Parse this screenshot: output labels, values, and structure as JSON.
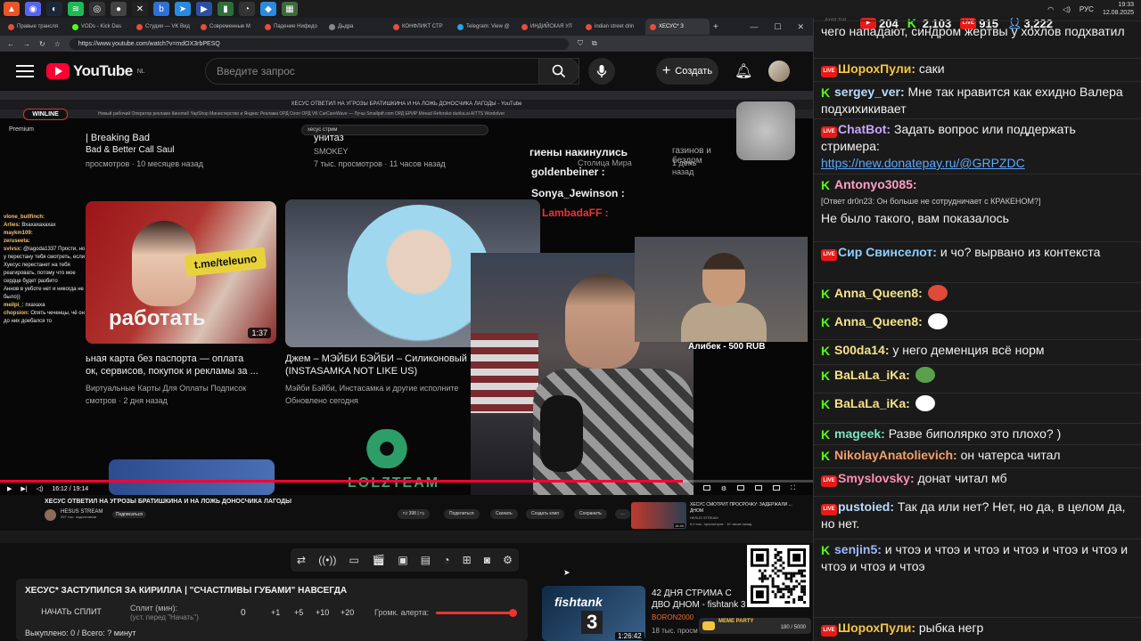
{
  "os": {
    "clock_time": "19:33",
    "clock_date": "12.08.2025",
    "lang": "РУС"
  },
  "browser": {
    "tabs": [
      {
        "label": "Правые трансля",
        "color": "#e74c3c"
      },
      {
        "label": "VODs - Kick Das",
        "color": "#53fc18"
      },
      {
        "label": "Студия — VK Вид",
        "color": "#e74c3c"
      },
      {
        "label": "Современные М",
        "color": "#e74c3c"
      },
      {
        "label": "Падение Нифедо",
        "color": "#e74c3c"
      },
      {
        "label": "Дьдра",
        "color": "#888888"
      },
      {
        "label": "КОНФЛИКТ СТР",
        "color": "#e74c3c"
      },
      {
        "label": "Telegram: View @",
        "color": "#2aa3e0"
      },
      {
        "label": "ИНДИЙСКАЯ УЛ",
        "color": "#e74c3c"
      },
      {
        "label": "indian street drin",
        "color": "#e74c3c"
      },
      {
        "label": "ХЕСУС* З",
        "color": "#e74c3c",
        "active": true
      }
    ],
    "url": "https://www.youtube.com/watch?v=mdOX3rbPESQ"
  },
  "youtube": {
    "logo_text": "YouTube",
    "region": "NL",
    "search_placeholder": "Введите запрос",
    "create_label": "Создать"
  },
  "player": {
    "winline": "WINLINE",
    "premium": "Premium",
    "inner_page_title": "ХЕСУС ОТВЕТИЛ НА УГРОЗЫ БРАТИШКИНА И НА ЛОЖЬ ДОНОСЧИКА ЛАГОДЫ - YouTube",
    "inner_bookmarks": "Новый рабочий   Оператор рекламн   Кинопаб   YapShop   Министерство и   Яндекс Реклама   ОРД Ozon   ОРД VK   CarCareWave — Лучш   Smallpdf.com   ОРД ЕРИР   Miread   Reforoko   durika.ai   AITTS   Wordolver",
    "inner_search": "хесус стрим",
    "videos": [
      {
        "title": "Bad & Better Call Saul",
        "meta": "просмотров · 10 месяцев назад",
        "title_pre": "| Breaking Bad"
      },
      {
        "title": "унитаз",
        "channel": "SMOKEY",
        "meta": "7 тыс. просмотров · 11 часов назад"
      },
      {
        "title": "ьная карта без паспорта — оплата",
        "title2": "ок, сервисов, покупок и рекламы за ...",
        "meta": "Виртуальные Карты Для Оплаты Подписок",
        "meta2": "смотров · 2 дня назад",
        "duration": "1:37",
        "thumb_tag": "t.me/teleuno",
        "thumb_caption": "работать"
      },
      {
        "title": "Джем – МЭЙБИ БЭЙБИ – Силиконовый",
        "title2": "(INSTASAMKA NOT LIKE US)",
        "meta": "Мэйби Бэйби, Инстасамка и другие исполните",
        "meta2": "Обновлено сегодня"
      }
    ],
    "overlay_right": {
      "line1": "гиены накинулись",
      "line1_sub": "Столица Мира",
      "line2": "goldenbeiner :",
      "line3": "Sonya_Jewinson :",
      "line4": "LambadaFF :",
      "top_text": "газинов и бездом",
      "top_meta": "1 день назад"
    },
    "chat_overlay": [
      {
        "user": "vlone_bullfinch:",
        "text": ""
      },
      {
        "user": "Arlies:",
        "text": "Вхахахахахах"
      },
      {
        "user": "maykm109:",
        "text": ""
      },
      {
        "user": "zeruseeta:",
        "text": ""
      },
      {
        "user": "svivsx:",
        "text": "@lagoda1337 Прости, но у перестану тебя смотреть, если Хуесус перестанет на тебя реагировать, потому что мое сердце будет разбито"
      },
      {
        "user": "",
        "text": "Аннов в уеботе нет и никогда не было))"
      },
      {
        "user": "meilpi_:",
        "text": "пхахаха"
      },
      {
        "user": "chopsion:",
        "text": "Опять чеченцы, чё он до них доебался то"
      }
    ],
    "donation": "Алибек - 500 RUB",
    "lolz": "LOLZTEAM",
    "time_current": "16:12",
    "time_total": "19:14",
    "progress": 0.84
  },
  "inner_info": {
    "title": "ХЕСУС ОТВЕТИЛ НА УГРОЗЫ БРАТИШКИНА И НА ЛОЖЬ ДОНОСЧИКА ЛАГОДЫ",
    "channel": "HESUS STREAM",
    "subs": "397 тыс. подписчиков",
    "subscribe": "Подписаться",
    "likes": "398",
    "share": "Поделиться",
    "download": "Скачать",
    "clip": "Создать клип",
    "save": "Сохранить",
    "rec_title": "ХЕСУС СМОТРИТ ПРОСРОЧКУ: ЗАДЕРЖАЛИ ... ДНОМ",
    "rec_channel": "HESUS STREAM",
    "rec_meta": "6,9 тыс. просмотров · 10 часов назад",
    "rec_duration": "16:40"
  },
  "split": {
    "title": "ХЕСУС* ЗАСТУПИЛСЯ ЗА КИРИЛЛА | \"СЧАСТЛИВЫ ГУБАМИ\" НАВСЕГДА",
    "start": "НАЧАТЬ СПЛИТ",
    "label": "Сплит (мин):",
    "sub": "(уст. перед \"Начать\")",
    "value": "0",
    "incs": [
      "+1",
      "+5",
      "+10",
      "+20"
    ],
    "alert_label": "Громк. алерта:",
    "alert_volume": 1.0,
    "bought": "Выкуплено: 0 / Всего: ? минут"
  },
  "next_video": {
    "title": "42 ДНЯ СТРИМА С ДВО ДНОМ - fishtank 3",
    "channel": "BORON2000",
    "views": "18 тыс. просм",
    "duration": "1:26:42",
    "thumb_word": "fishtank",
    "thumb_num": "3"
  },
  "meme": {
    "label": "MEME PARTY",
    "count": "180 / 5000"
  },
  "chat": {
    "app": "AxelChat",
    "stats": {
      "youtube": "204",
      "kick": "2,103",
      "live": "915",
      "viewers": "3,222"
    },
    "messages": [
      {
        "platform": "top",
        "user": "",
        "text": "чего нападают, синдром жертвы у хохлов подхватил",
        "color": "#f1f1f1"
      },
      {
        "platform": "live",
        "user": "ШорохПули:",
        "text": "саки",
        "color": "#f5c542"
      },
      {
        "platform": "kick",
        "user": "sergey_ver:",
        "text": "Мне так нравится как ехидно Валера подхихикивает",
        "color": "#b9dcff"
      },
      {
        "platform": "live",
        "user": "ChatBot:",
        "text": "Задать вопрос или поддержать стримера:",
        "link": "https://new.donatepay.ru/@GRPZDC",
        "color": "#c9a4ff"
      },
      {
        "platform": "kick",
        "user": "Antonyo3085:",
        "reply": "[Ответ dr0n23: Он больше не сотрудничает с КРАКЕНОМ?]",
        "text": "Не было такого, вам показалось",
        "color": "#ff9fc6"
      },
      {
        "platform": "live",
        "user": "Сир Свинселот:",
        "text": "и чо? вырвано из контекста",
        "color": "#8fd0ff"
      },
      {
        "platform": "kick",
        "user": "Anna_Queen8:",
        "text": "",
        "color": "#f5e38a"
      },
      {
        "platform": "kick",
        "user": "Anna_Queen8:",
        "text": "",
        "color": "#f5e38a"
      },
      {
        "platform": "kick",
        "user": "S00da14:",
        "text": "у него деменция всё норм",
        "color": "#f5e38a"
      },
      {
        "platform": "kick",
        "user": "BaLaLa_iKa:",
        "text": "",
        "color": "#f5e38a"
      },
      {
        "platform": "kick",
        "user": "BaLaLa_iKa:",
        "text": "",
        "color": "#f5e38a"
      },
      {
        "platform": "kick",
        "user": "mageek:",
        "text": "Разве биполярко это плохо? )",
        "color": "#7fe3c0"
      },
      {
        "platform": "kick",
        "user": "NikolayAnatolievich:",
        "text": "он чатерса читал",
        "color": "#f5a06a"
      },
      {
        "platform": "live",
        "user": "Smyslovsky:",
        "text": "донат читал мб",
        "color": "#ff8fb2"
      },
      {
        "platform": "live",
        "user": "pustoied:",
        "text": "Так да или нет? Нет, но да, в целом да, но нет.",
        "color": "#b9dcff"
      },
      {
        "platform": "kick",
        "user": "senjin5:",
        "text": "и чтоэ  и чтоэ  и чтоэ  и чтоэ  и чтоэ  и чтоэ  и чтоэ  и чтоэ  и чтоэ",
        "color": "#9fb8ff"
      },
      {
        "platform": "live",
        "user": "ШорохПули:",
        "text": "рыбка негр",
        "color": "#f5c542"
      }
    ]
  }
}
